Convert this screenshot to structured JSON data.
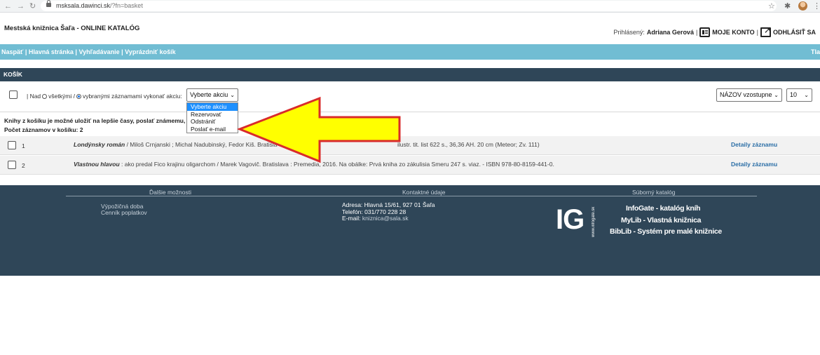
{
  "browser": {
    "url_host": "msksala.dawinci.sk",
    "url_path": "/?fn=basket",
    "back": "←",
    "forward": "→",
    "reload": "↻"
  },
  "header": {
    "site_title": "Mestská knižnica Šaľa - ONLINE KATALÓG",
    "logged_label": "Prihlásený:",
    "user_name": "Adriana Gerová",
    "my_account": "MOJE KONTO",
    "logout": "ODHLÁSIŤ SA"
  },
  "nav": {
    "back": "Naspäť",
    "home": "Hlavná stránka",
    "search": "Vyhľadávanie",
    "empty": "Vyprázdniť košík",
    "right_cut": "Tla"
  },
  "basket": {
    "title": "KOŠÍK",
    "over_label": "| Nad",
    "all_label": "všetkými /",
    "selected_label": "vybranými záznamami vykonať akciu:",
    "action_select": "Vyberte akciu",
    "action_options": [
      "Vyberte akciu",
      "Rezervovať",
      "Odstrániť",
      "Poslať e-mail"
    ],
    "sort_select": "NÁZOV vzostupne",
    "per_page": "10",
    "info_text": "Knihy z košíku je možné uložiť na lepšie časy, poslať známemu, a",
    "count_text": "Počet záznamov v košíku: 2",
    "rows": [
      {
        "num": "1",
        "title": "Londýnsky román",
        "rest": " / Miloš Crnjanski ; Michal Nadubinský, Fedor Kiš. Bratisla",
        "tail": "ilustr. tit. list 622 s., 36,36 AH. 20 cm (Meteor; Zv. 111)",
        "detail": "Detaily záznamu"
      },
      {
        "num": "2",
        "title": "Vlastnou hlavou",
        "rest": " : ako predal Fico krajinu oligarchom / Marek Vagovič. Bratislava : Premedia, 2016. Na obálke: Prvá kniha zo zákulisia Smeru 247 s. viaz. - ISBN 978-80-8159-441-0.",
        "tail": "",
        "detail": "Detaily záznamu"
      }
    ]
  },
  "footer": {
    "col1_head": "Ďalšie možnosti",
    "col2_head": "Kontaktné údaje",
    "col3_head": "Súborný katalóg",
    "links": [
      "Výpožičná doba",
      "Cenník poplatkov"
    ],
    "address": "Adresa: Hlavná 15/61, 927 01 Šaľa",
    "phone": "Telefón: 031/770 228 28",
    "email_label": "E-mail:",
    "email": "kniznica@sala.sk",
    "logo": "IG",
    "logo_side": "www.infogate.sk",
    "products": [
      "InfoGate - katalóg kníh",
      "MyLib - Vlastná knižnica",
      "BibLib - Systém pre malé knižnice"
    ]
  },
  "colors": {
    "nav_blue": "#71bdd3",
    "dark_navy": "#2f4658",
    "arrow_yellow": "#ffff00",
    "arrow_border": "#d92b2b",
    "link_blue": "#2b6ea6"
  }
}
